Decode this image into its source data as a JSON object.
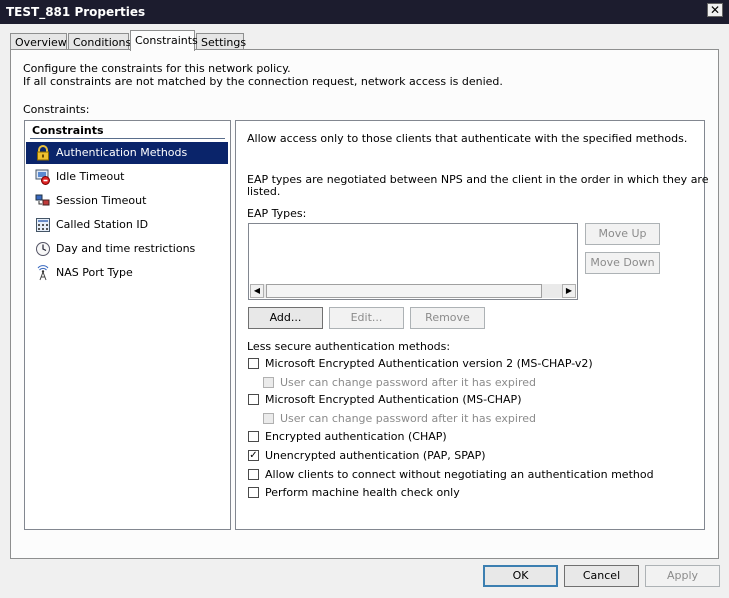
{
  "window": {
    "title": "TEST_881 Properties",
    "close_glyph": "✕"
  },
  "tabs": [
    {
      "label": "Overview"
    },
    {
      "label": "Conditions"
    },
    {
      "label": "Constraints"
    },
    {
      "label": "Settings"
    }
  ],
  "active_tab": "Constraints",
  "intro": {
    "line1": "Configure the constraints for this network policy.",
    "line2": "If all constraints are not matched by the connection request, network access is denied."
  },
  "constraints_label": "Constraints:",
  "left_list": {
    "header": "Constraints",
    "items": [
      {
        "label": "Authentication Methods",
        "icon": "lock-icon",
        "selected": true
      },
      {
        "label": "Idle Timeout",
        "icon": "idle-timeout-icon",
        "selected": false
      },
      {
        "label": "Session Timeout",
        "icon": "session-timeout-icon",
        "selected": false
      },
      {
        "label": "Called Station ID",
        "icon": "called-station-icon",
        "selected": false
      },
      {
        "label": "Day and time restrictions",
        "icon": "clock-icon",
        "selected": false
      },
      {
        "label": "NAS Port Type",
        "icon": "antenna-icon",
        "selected": false
      }
    ]
  },
  "right_panel": {
    "allow_text": "Allow access only to those clients that authenticate with the specified methods.",
    "eap_desc_line1": "EAP types are negotiated between NPS and the client in the order in which they are",
    "eap_desc_line2": "listed.",
    "eap_types_label": "EAP Types:",
    "move_up": "Move Up",
    "move_down": "Move Down",
    "add": "Add...",
    "edit": "Edit...",
    "remove": "Remove",
    "less_secure_label": "Less secure authentication methods:",
    "methods": [
      {
        "label": "Microsoft Encrypted Authentication version 2 (MS-CHAP-v2)",
        "checked": false,
        "enabled": true
      },
      {
        "label": "User can change password after it has expired",
        "checked": false,
        "enabled": false,
        "indent": true
      },
      {
        "label": "Microsoft Encrypted Authentication (MS-CHAP)",
        "checked": false,
        "enabled": true
      },
      {
        "label": "User can change password after it has expired",
        "checked": false,
        "enabled": false,
        "indent": true
      },
      {
        "label": "Encrypted authentication (CHAP)",
        "checked": false,
        "enabled": true
      },
      {
        "label": "Unencrypted authentication (PAP, SPAP)",
        "checked": true,
        "enabled": true
      },
      {
        "label": "Allow clients to connect without negotiating an authentication method",
        "checked": false,
        "enabled": true
      },
      {
        "label": "Perform machine health check only",
        "checked": false,
        "enabled": true
      }
    ],
    "check_glyph": "✓"
  },
  "footer": {
    "ok": "OK",
    "cancel": "Cancel",
    "apply": "Apply"
  },
  "colors": {
    "selection": "#0a246a",
    "titlebar": "#1c1c2e"
  }
}
